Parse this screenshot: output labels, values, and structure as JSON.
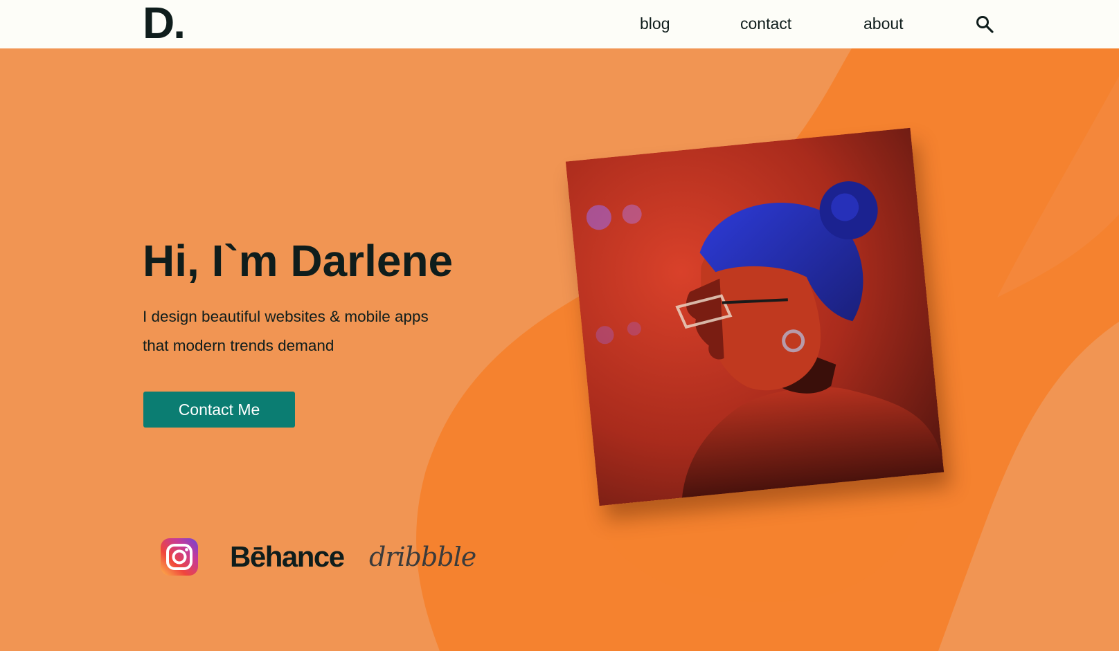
{
  "header": {
    "logo": "D.",
    "nav": [
      {
        "label": "blog"
      },
      {
        "label": "contact"
      },
      {
        "label": "about"
      }
    ],
    "search_icon": "search-icon"
  },
  "hero": {
    "title": "Hi, I`m Darlene",
    "subtitle": "I design beautiful websites & mobile apps that modern trends demand",
    "cta_label": "Contact Me",
    "photo": "portrait-photo"
  },
  "social": {
    "instagram_icon": "instagram-icon",
    "behance_label": "Bēhance",
    "dribbble_label": "dribbble"
  },
  "colors": {
    "header_bg": "#fdfdf8",
    "hero_bg": "#f19553",
    "blob": "#f5822f",
    "text_dark": "#0f1d1c",
    "cta_bg": "#0b7d72"
  }
}
